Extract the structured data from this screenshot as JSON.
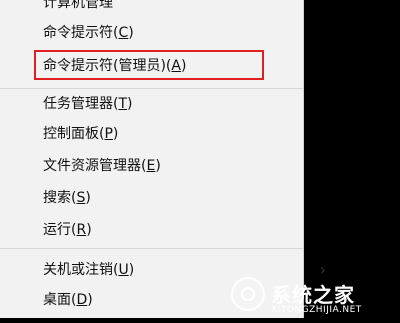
{
  "menu": {
    "items": [
      {
        "label": "计算机管理",
        "accel": "",
        "suffix": ""
      },
      {
        "label": "命令提示符(",
        "accel": "C",
        "suffix": ")"
      },
      {
        "label": "命令提示符(管理员)(",
        "accel": "A",
        "suffix": ")"
      },
      {
        "label": "任务管理器(",
        "accel": "T",
        "suffix": ")"
      },
      {
        "label": "控制面板(",
        "accel": "P",
        "suffix": ")"
      },
      {
        "label": "文件资源管理器(",
        "accel": "E",
        "suffix": ")"
      },
      {
        "label": "搜索(",
        "accel": "S",
        "suffix": ")"
      },
      {
        "label": "运行(",
        "accel": "R",
        "suffix": ")"
      },
      {
        "label": "关机或注销(",
        "accel": "U",
        "suffix": ")"
      },
      {
        "label": "桌面(",
        "accel": "D",
        "suffix": ")"
      }
    ],
    "submenu_arrow": "›"
  },
  "watermark": {
    "title": "系统之家",
    "url": "XITONGZHIJIA.NET"
  },
  "colors": {
    "highlight": "#e02020",
    "menu_bg": "#f2f2f2"
  }
}
